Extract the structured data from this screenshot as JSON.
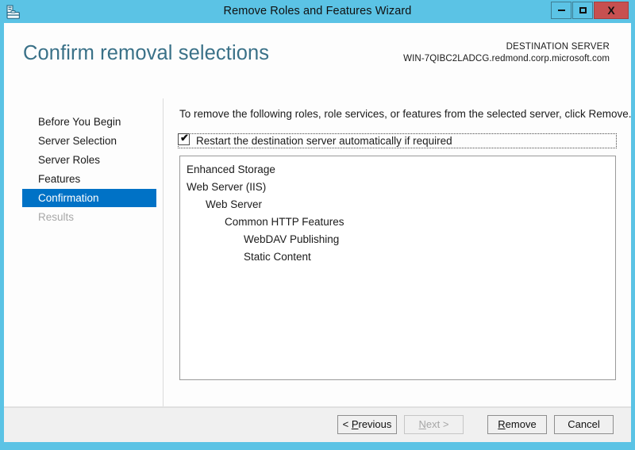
{
  "window": {
    "title": "Remove Roles and Features Wizard",
    "icon": "server-manager-icon",
    "caption_buttons": {
      "minimize": "–",
      "maximize": "□",
      "close": "X"
    },
    "frame_color": "#5BC3E5",
    "close_color": "#C75050"
  },
  "header": {
    "page_title": "Confirm removal selections",
    "title_color": "#3A7188",
    "destination_label": "DESTINATION SERVER",
    "destination_server": "WIN-7QIBC2LADCG.redmond.corp.microsoft.com"
  },
  "sidebar": {
    "selected_color": "#0072C6",
    "items": [
      {
        "label": "Before You Begin",
        "state": "normal"
      },
      {
        "label": "Server Selection",
        "state": "normal"
      },
      {
        "label": "Server Roles",
        "state": "normal"
      },
      {
        "label": "Features",
        "state": "normal"
      },
      {
        "label": "Confirmation",
        "state": "selected"
      },
      {
        "label": "Results",
        "state": "disabled"
      }
    ]
  },
  "main": {
    "intro_text": "To remove the following roles, role services, or features from the selected server, click Remove.",
    "restart_checkbox": {
      "label": "Restart the destination server automatically if required",
      "checked": true,
      "tick_glyph": "✔"
    },
    "removal_items": [
      {
        "label": "Enhanced Storage",
        "indent": 0
      },
      {
        "label": "Web Server (IIS)",
        "indent": 0
      },
      {
        "label": "Web Server",
        "indent": 1
      },
      {
        "label": "Common HTTP Features",
        "indent": 2
      },
      {
        "label": "WebDAV Publishing",
        "indent": 3
      },
      {
        "label": "Static Content",
        "indent": 3
      }
    ]
  },
  "footer": {
    "buttons": [
      {
        "name": "previous",
        "prefix": "< ",
        "accesskey": "P",
        "suffix": "revious",
        "enabled": true
      },
      {
        "name": "next",
        "prefix": "",
        "accesskey": "N",
        "suffix": "ext >",
        "enabled": false
      },
      {
        "name": "remove",
        "prefix": "",
        "accesskey": "R",
        "suffix": "emove",
        "enabled": true
      },
      {
        "name": "cancel",
        "prefix": "",
        "accesskey": "",
        "suffix": "Cancel",
        "enabled": true
      }
    ]
  }
}
